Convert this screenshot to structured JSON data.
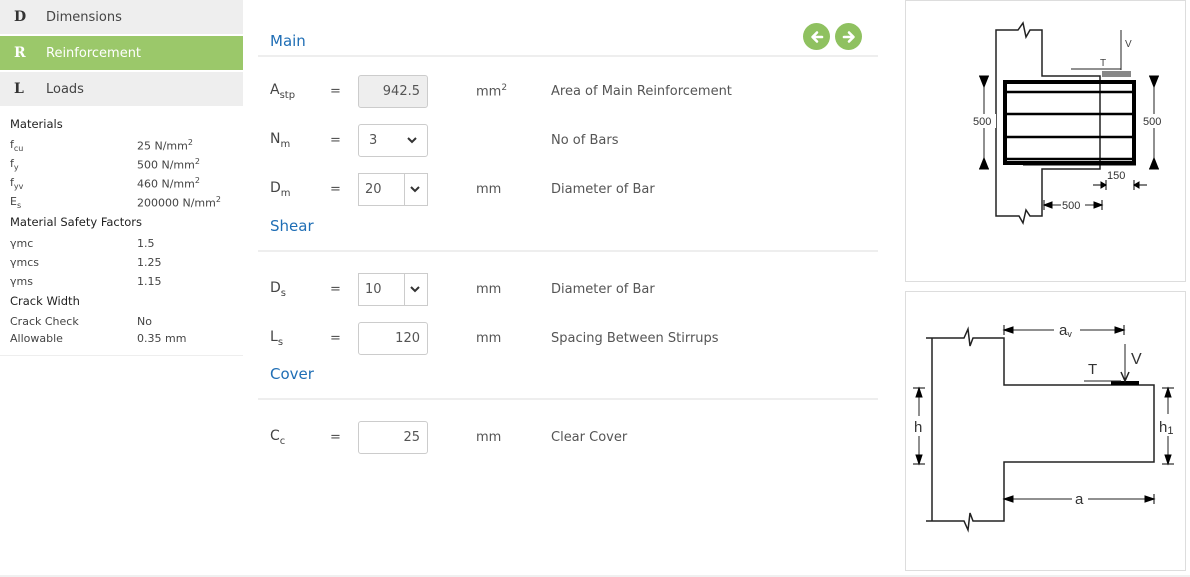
{
  "nav": [
    {
      "letter": "D",
      "label": "Dimensions",
      "active": false
    },
    {
      "letter": "R",
      "label": "Reinforcement",
      "active": true
    },
    {
      "letter": "L",
      "label": "Loads",
      "active": false
    }
  ],
  "summary": {
    "materials_title": "Materials",
    "materials": [
      {
        "sym": "f",
        "sub": "cu",
        "value": "25 N/mm",
        "sup": "2"
      },
      {
        "sym": "f",
        "sub": "y",
        "value": "500 N/mm",
        "sup": "2"
      },
      {
        "sym": "f",
        "sub": "yv",
        "value": "460 N/mm",
        "sup": "2"
      },
      {
        "sym": "E",
        "sub": "s",
        "value": "200000 N/mm",
        "sup": "2"
      }
    ],
    "safety_title": "Material Safety Factors",
    "safety": [
      {
        "sym": "γmc",
        "value": "1.5"
      },
      {
        "sym": "γmcs",
        "value": "1.25"
      },
      {
        "sym": "γms",
        "value": "1.15"
      }
    ],
    "crack_title": "Crack Width",
    "crack": [
      {
        "label": "Crack Check",
        "value": "No"
      },
      {
        "label": "Allowable",
        "value": "0.35 mm"
      }
    ]
  },
  "sections": {
    "main": "Main",
    "shear": "Shear",
    "cover": "Cover"
  },
  "fields": {
    "astp": {
      "sym": "A",
      "sub": "stp",
      "eq": "=",
      "value": "942.5",
      "unit": "mm",
      "unit_sup": "2",
      "desc": "Area of Main Reinforcement"
    },
    "nm": {
      "sym": "N",
      "sub": "m",
      "eq": "=",
      "value": "3",
      "unit": "",
      "desc": "No of Bars"
    },
    "dm": {
      "sym": "D",
      "sub": "m",
      "eq": "=",
      "value": "20",
      "unit": "mm",
      "desc": "Diameter of Bar"
    },
    "ds": {
      "sym": "D",
      "sub": "s",
      "eq": "=",
      "value": "10",
      "unit": "mm",
      "desc": "Diameter of Bar"
    },
    "ls": {
      "sym": "L",
      "sub": "s",
      "eq": "=",
      "value": "120",
      "unit": "mm",
      "desc": "Spacing Between Stirrups"
    },
    "cc": {
      "sym": "C",
      "sub": "c",
      "eq": "=",
      "value": "25",
      "unit": "mm",
      "desc": "Clear Cover"
    }
  },
  "diagram1": {
    "h_left": "500",
    "h_right": "500",
    "bearing": "150",
    "length": "500",
    "V": "V",
    "T": "T"
  },
  "diagram2": {
    "av": "av",
    "V": "V",
    "T": "T",
    "h": "h",
    "h1": "h1",
    "a": "a"
  },
  "colors": {
    "accent_green": "#9bc86a",
    "section_blue": "#1f6eb5"
  }
}
